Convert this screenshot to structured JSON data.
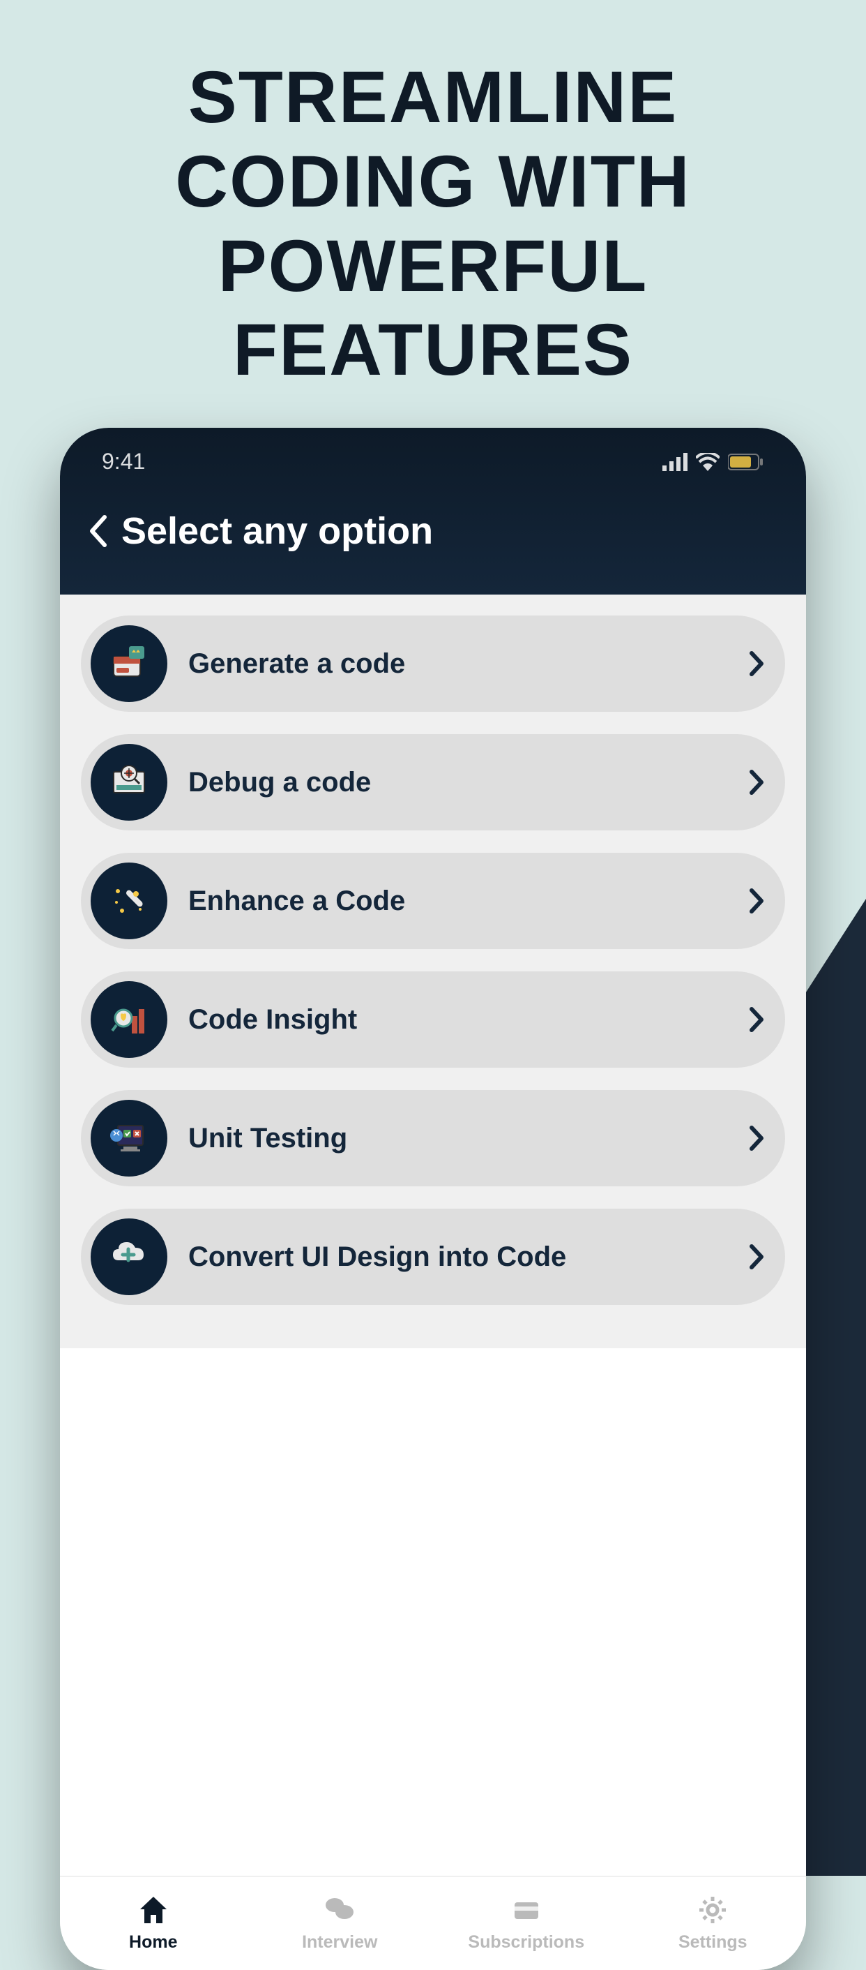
{
  "marketing": {
    "title": "Streamline Coding with Powerful Features"
  },
  "status": {
    "time": "9:41"
  },
  "header": {
    "title": "Select any option"
  },
  "options": [
    {
      "label": "Generate a code"
    },
    {
      "label": "Debug a code"
    },
    {
      "label": "Enhance  a Code"
    },
    {
      "label": "Code Insight"
    },
    {
      "label": "Unit Testing"
    },
    {
      "label": "Convert UI Design into Code"
    }
  ],
  "nav": {
    "home": "Home",
    "interview": "Interview",
    "subscriptions": "Subscriptions",
    "settings": "Settings"
  }
}
